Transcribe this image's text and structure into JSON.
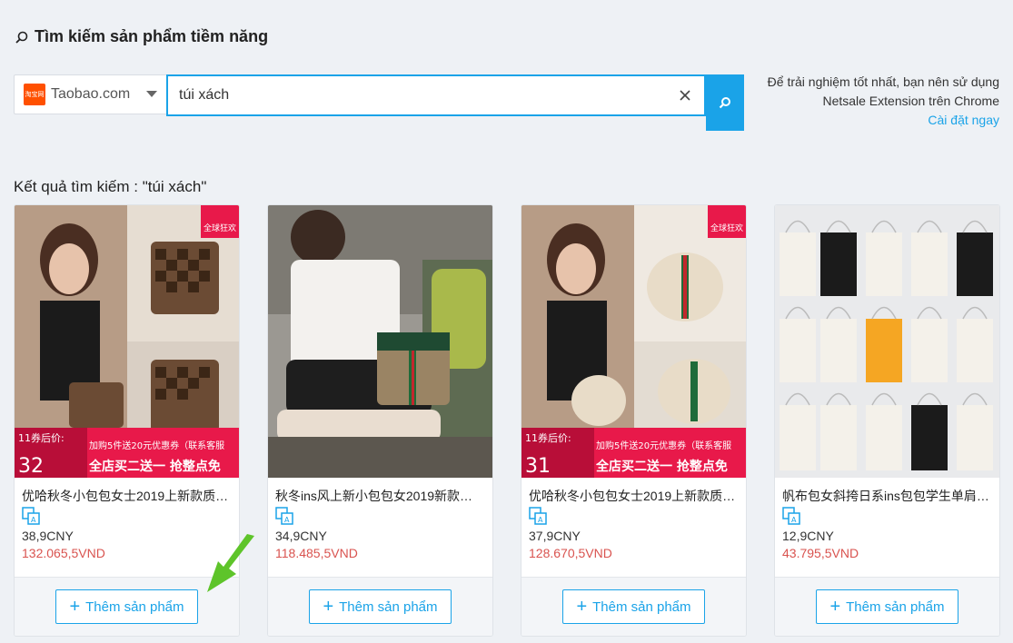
{
  "header": {
    "title": "Tìm kiếm sản phẩm tiềm năng",
    "icon": "search-icon"
  },
  "search": {
    "source_label": "Taobao.com",
    "source_logo_text": "淘宝网",
    "query": "túi xách",
    "placeholder": ""
  },
  "extension_note": {
    "text": "Để trải nghiệm tốt nhất, bạn nên sử dụng Netsale Extension trên Chrome",
    "link": "Cài đặt ngay"
  },
  "results": {
    "title": "Kết quả tìm kiếm : \"túi xách\"",
    "items": [
      {
        "title": "优哈秋冬小包包女士2019上新款质…",
        "price_cny": "38,9CNY",
        "price_vnd": "132.065,5VND",
        "add_label": "Thêm sản phẩm",
        "banner_top": "加购5件送20元优惠券（联系客服",
        "banner_bottom": "全店买二送一 抢整点免",
        "badge_num": "32",
        "badge_text": "11券后价:",
        "corner": "全球狂欢"
      },
      {
        "title": "秋冬ins风上新小包包女2019新款潮…",
        "price_cny": "34,9CNY",
        "price_vnd": "118.485,5VND",
        "add_label": "Thêm sản phẩm"
      },
      {
        "title": "优哈秋冬小包包女士2019上新款质…",
        "price_cny": "37,9CNY",
        "price_vnd": "128.670,5VND",
        "add_label": "Thêm sản phẩm",
        "banner_top": "加购5件送20元优惠券（联系客服",
        "banner_bottom": "全店买二送一 抢整点免",
        "badge_num": "31",
        "badge_text": "11券后价:",
        "corner": "全球狂欢"
      },
      {
        "title": "帆布包女斜挎日系ins包包学生单肩…",
        "price_cny": "12,9CNY",
        "price_vnd": "43.795,5VND",
        "add_label": "Thêm sản phẩm"
      }
    ]
  },
  "colors": {
    "accent": "#1aa3e8",
    "price_vnd": "#d9534f",
    "arrow": "#5ec42a",
    "banner": "#e8194a"
  }
}
